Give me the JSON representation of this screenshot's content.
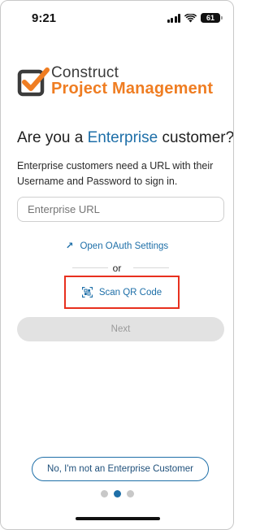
{
  "status_bar": {
    "time": "9:21",
    "battery": "61",
    "icons": [
      "signal-icon",
      "wifi-icon",
      "battery-icon"
    ]
  },
  "logo": {
    "line1": "Construct",
    "line2": "Project Management",
    "colors": {
      "brand_orange": "#ef7d22",
      "brand_dark": "#3b3b3b"
    }
  },
  "heading": {
    "prefix": "Are you a ",
    "accent": "Enterprise",
    "suffix": " customer?"
  },
  "subtext": "Enterprise customers need a URL with their Username and Password to sign in.",
  "url_input": {
    "placeholder": "Enterprise URL",
    "value": ""
  },
  "oauth_link": {
    "label": "Open OAuth Settings",
    "icon": "arrow-up-right-icon"
  },
  "divider_text": "or",
  "qr_button": {
    "label": "Scan QR Code",
    "icon": "qr-scan-icon"
  },
  "next_button": {
    "label": "Next",
    "enabled": false
  },
  "not_enterprise_button": {
    "label": "No, I'm not an Enterprise Customer"
  },
  "pager": {
    "pages": 3,
    "active": 2
  },
  "colors": {
    "accent": "#1e6fa8",
    "highlight": "#e8301e",
    "disabled_bg": "#e2e2e2",
    "disabled_text": "#9a9a9a"
  }
}
